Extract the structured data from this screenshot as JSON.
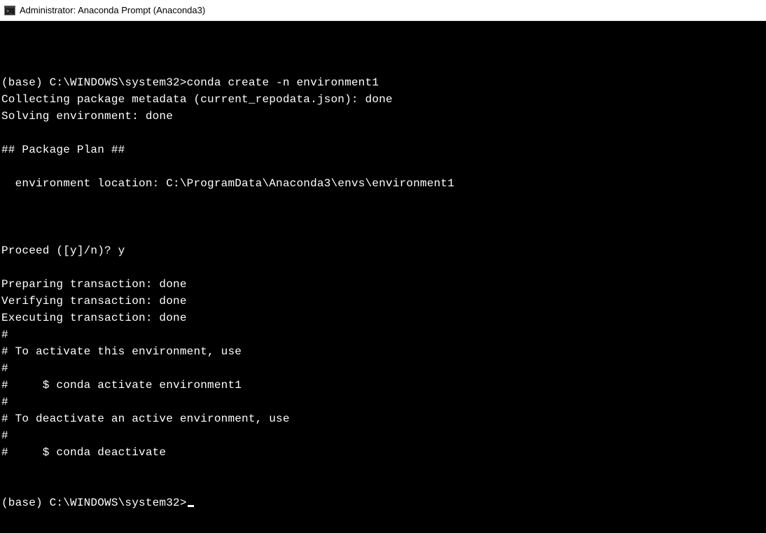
{
  "window": {
    "title": "Administrator: Anaconda Prompt (Anaconda3)"
  },
  "terminal": {
    "lines": [
      "",
      "(base) C:\\WINDOWS\\system32>conda create -n environment1",
      "Collecting package metadata (current_repodata.json): done",
      "Solving environment: done",
      "",
      "## Package Plan ##",
      "",
      "  environment location: C:\\ProgramData\\Anaconda3\\envs\\environment1",
      "",
      "",
      "",
      "Proceed ([y]/n)? y",
      "",
      "Preparing transaction: done",
      "Verifying transaction: done",
      "Executing transaction: done",
      "#",
      "# To activate this environment, use",
      "#",
      "#     $ conda activate environment1",
      "#",
      "# To deactivate an active environment, use",
      "#",
      "#     $ conda deactivate",
      "",
      ""
    ],
    "prompt": "(base) C:\\WINDOWS\\system32>"
  }
}
